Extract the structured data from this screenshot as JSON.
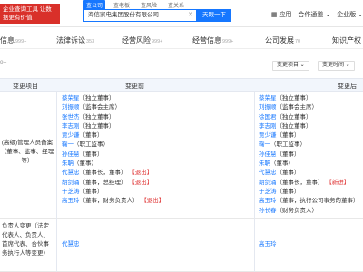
{
  "header": {
    "logo_text": "企业查询工具 让数据更有价值",
    "search_tabs": [
      "查公司",
      "查老板",
      "查风险",
      "查关系"
    ],
    "search_value": "海信家电集团股份有限公司",
    "search_button": "天眼一下",
    "nav": [
      "应用",
      "合作通道",
      "企业版"
    ]
  },
  "category_tabs": [
    {
      "label": "信息",
      "count": "999+"
    },
    {
      "label": "法律诉讼",
      "count": "353"
    },
    {
      "label": "经营风险",
      "count": "999+"
    },
    {
      "label": "经营信息",
      "count": "999+"
    },
    {
      "label": "公司发展",
      "count": "70"
    },
    {
      "label": "知识产权",
      "count": ""
    }
  ],
  "filter": {
    "label_left": "9+",
    "change_item_button": "变更项目",
    "change_time_button": "变更时间"
  },
  "table": {
    "headers": [
      "变更项目",
      "变更前",
      "变更后"
    ],
    "rows": [
      {
        "item": "(高级)管理人员备案（董事、监事、经理等）",
        "before": [
          {
            "name": "蔡荣星",
            "role": "（独立董事）",
            "tag": ""
          },
          {
            "name": "刘振顺",
            "role": "（监事会主席）",
            "tag": ""
          },
          {
            "name": "张世杰",
            "role": "（独立董事）",
            "tag": ""
          },
          {
            "name": "李志刚",
            "role": "（独立董事）",
            "tag": ""
          },
          {
            "name": "贾少谦",
            "role": "（董事）",
            "tag": ""
          },
          {
            "name": "鞠一",
            "role": "（职工监事）",
            "tag": ""
          },
          {
            "name": "孙佳慧",
            "role": "（董事）",
            "tag": ""
          },
          {
            "name": "朱聃",
            "role": "（董事）",
            "tag": ""
          },
          {
            "name": "代慧忠",
            "role": "（董事长，董事）",
            "tag": "【退出】"
          },
          {
            "name": "胡剑涌",
            "role": "（董事，总经理）",
            "tag": "【退出】"
          },
          {
            "name": "于芝涛",
            "role": "（董事）",
            "tag": ""
          },
          {
            "name": "高玉玲",
            "role": "（董事，财务负责人）",
            "tag": "【退出】"
          }
        ],
        "after": [
          {
            "name": "蔡荣星",
            "role": "（独立董事）",
            "tag": ""
          },
          {
            "name": "刘振顺",
            "role": "（监事会主席）",
            "tag": ""
          },
          {
            "name": "徐国君",
            "role": "（独立董事）",
            "tag": ""
          },
          {
            "name": "李志刚",
            "role": "（独立董事）",
            "tag": ""
          },
          {
            "name": "贾少谦",
            "role": "（董事）",
            "tag": ""
          },
          {
            "name": "鞠一",
            "role": "（职工监事）",
            "tag": ""
          },
          {
            "name": "孙佳慧",
            "role": "（董事）",
            "tag": ""
          },
          {
            "name": "朱聃",
            "role": "（董事）",
            "tag": ""
          },
          {
            "name": "代慧忠",
            "role": "（董事）",
            "tag": ""
          },
          {
            "name": "胡剑涌",
            "role": "（董事长，董事）",
            "tag": "【新进】"
          },
          {
            "name": "于芝涛",
            "role": "（董事）",
            "tag": ""
          },
          {
            "name": "高玉玲",
            "role": "（董事，执行公司事务的董事）",
            "tag": ""
          },
          {
            "name": "孙长春",
            "role": "（财务负责人）",
            "tag": ""
          }
        ]
      },
      {
        "item": "负责人变更（法定代表人、负责人、首席代表、合伙事务执行人等变更）",
        "before": [
          {
            "name": "代慧忠",
            "role": "",
            "tag": ""
          }
        ],
        "after": [
          {
            "name": "高玉玲",
            "role": "",
            "tag": ""
          }
        ]
      }
    ]
  },
  "colors": {
    "accent": "#1677ff",
    "brand_red": "#d9302a",
    "tag_red": "#e03a3a"
  }
}
